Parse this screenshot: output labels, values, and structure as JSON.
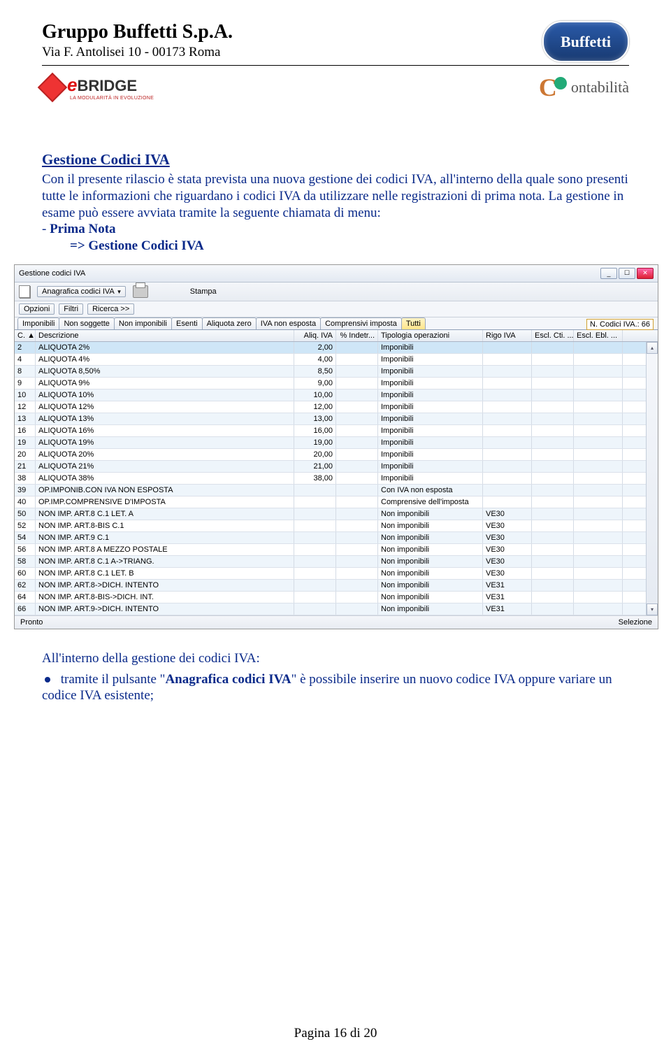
{
  "header": {
    "company": "Gruppo Buffetti S.p.A.",
    "address": "Via F. Antolisei 10 - 00173 Roma",
    "badge_text": "Buffetti"
  },
  "logos": {
    "ebridge_e": "e",
    "ebridge_name": "BRIDGE",
    "ebridge_sub": "LA MODULARITÀ IN EVOLUZIONE",
    "contab_c": "C",
    "contab_text": "ontabilità"
  },
  "section": {
    "title": "Gestione Codici IVA",
    "para1": "Con il presente rilascio è stata prevista una nuova gestione dei codici IVA, all'interno della quale sono presenti tutte le informazioni che riguardano i codici IVA da utilizzare nelle registrazioni di prima nota. La gestione in esame può essere avviata tramite la seguente chiamata di menu:",
    "menu_dash": "- ",
    "menu1": "Prima Nota",
    "menu_arrow": "=> Gestione Codici IVA"
  },
  "shot": {
    "title": "Gestione codici IVA",
    "win_min": "_",
    "win_max": "☐",
    "win_close": "✕",
    "toolbar": {
      "anag": "Anagrafica codici IVA",
      "anag_dd": "▾",
      "stampa": "Stampa"
    },
    "opts": {
      "opzioni": "Opzioni",
      "filtri": "Filtri",
      "ricerca": "Ricerca >>"
    },
    "tabs": [
      "Imponibili",
      "Non soggette",
      "Non imponibili",
      "Esenti",
      "Aliquota zero",
      "IVA non esposta",
      "Comprensivi imposta",
      "Tutti"
    ],
    "active_tab": 7,
    "ncodici": "N. Codici IVA.: 66",
    "cols": {
      "c": "C.",
      "desc": "Descrizione",
      "aliq": "Aliq. IVA",
      "ind": "% Indetr...",
      "tipo": "Tipologia operazioni",
      "rigo": "Rigo IVA",
      "escc": "Escl. Cti. ...",
      "esce": "Escl. Ebl. ..."
    },
    "col_sort": "▲",
    "rows": [
      {
        "c": "2",
        "desc": "ALIQUOTA 2%",
        "aliq": "2,00",
        "ind": "",
        "tipo": "Imponibili",
        "rigo": "",
        "escc": "",
        "esce": "",
        "sel": true
      },
      {
        "c": "4",
        "desc": "ALIQUOTA 4%",
        "aliq": "4,00",
        "ind": "",
        "tipo": "Imponibili",
        "rigo": "",
        "escc": "",
        "esce": ""
      },
      {
        "c": "8",
        "desc": "ALIQUOTA 8,50%",
        "aliq": "8,50",
        "ind": "",
        "tipo": "Imponibili",
        "rigo": "",
        "escc": "",
        "esce": ""
      },
      {
        "c": "9",
        "desc": "ALIQUOTA 9%",
        "aliq": "9,00",
        "ind": "",
        "tipo": "Imponibili",
        "rigo": "",
        "escc": "",
        "esce": ""
      },
      {
        "c": "10",
        "desc": "ALIQUOTA 10%",
        "aliq": "10,00",
        "ind": "",
        "tipo": "Imponibili",
        "rigo": "",
        "escc": "",
        "esce": ""
      },
      {
        "c": "12",
        "desc": "ALIQUOTA 12%",
        "aliq": "12,00",
        "ind": "",
        "tipo": "Imponibili",
        "rigo": "",
        "escc": "",
        "esce": ""
      },
      {
        "c": "13",
        "desc": "ALIQUOTA 13%",
        "aliq": "13,00",
        "ind": "",
        "tipo": "Imponibili",
        "rigo": "",
        "escc": "",
        "esce": ""
      },
      {
        "c": "16",
        "desc": "ALIQUOTA 16%",
        "aliq": "16,00",
        "ind": "",
        "tipo": "Imponibili",
        "rigo": "",
        "escc": "",
        "esce": ""
      },
      {
        "c": "19",
        "desc": "ALIQUOTA 19%",
        "aliq": "19,00",
        "ind": "",
        "tipo": "Imponibili",
        "rigo": "",
        "escc": "",
        "esce": ""
      },
      {
        "c": "20",
        "desc": "ALIQUOTA 20%",
        "aliq": "20,00",
        "ind": "",
        "tipo": "Imponibili",
        "rigo": "",
        "escc": "",
        "esce": ""
      },
      {
        "c": "21",
        "desc": "ALIQUOTA 21%",
        "aliq": "21,00",
        "ind": "",
        "tipo": "Imponibili",
        "rigo": "",
        "escc": "",
        "esce": ""
      },
      {
        "c": "38",
        "desc": "ALIQUOTA 38%",
        "aliq": "38,00",
        "ind": "",
        "tipo": "Imponibili",
        "rigo": "",
        "escc": "",
        "esce": ""
      },
      {
        "c": "39",
        "desc": "OP.IMPONIB.CON IVA NON ESPOSTA",
        "aliq": "",
        "ind": "",
        "tipo": "Con IVA non esposta",
        "rigo": "",
        "escc": "",
        "esce": ""
      },
      {
        "c": "40",
        "desc": "OP.IMP.COMPRENSIVE D'IMPOSTA",
        "aliq": "",
        "ind": "",
        "tipo": "Comprensive dell'imposta",
        "rigo": "",
        "escc": "",
        "esce": ""
      },
      {
        "c": "50",
        "desc": "NON IMP. ART.8 C.1 LET. A",
        "aliq": "",
        "ind": "",
        "tipo": "Non imponibili",
        "rigo": "VE30",
        "escc": "",
        "esce": ""
      },
      {
        "c": "52",
        "desc": "NON IMP. ART.8-BIS C.1",
        "aliq": "",
        "ind": "",
        "tipo": "Non imponibili",
        "rigo": "VE30",
        "escc": "",
        "esce": ""
      },
      {
        "c": "54",
        "desc": "NON IMP. ART.9 C.1",
        "aliq": "",
        "ind": "",
        "tipo": "Non imponibili",
        "rigo": "VE30",
        "escc": "",
        "esce": ""
      },
      {
        "c": "56",
        "desc": "NON IMP. ART.8 A MEZZO POSTALE",
        "aliq": "",
        "ind": "",
        "tipo": "Non imponibili",
        "rigo": "VE30",
        "escc": "",
        "esce": ""
      },
      {
        "c": "58",
        "desc": "NON IMP. ART.8 C.1 A->TRIANG.",
        "aliq": "",
        "ind": "",
        "tipo": "Non imponibili",
        "rigo": "VE30",
        "escc": "",
        "esce": ""
      },
      {
        "c": "60",
        "desc": "NON IMP. ART.8 C.1 LET. B",
        "aliq": "",
        "ind": "",
        "tipo": "Non imponibili",
        "rigo": "VE30",
        "escc": "",
        "esce": ""
      },
      {
        "c": "62",
        "desc": "NON IMP. ART.8->DICH. INTENTO",
        "aliq": "",
        "ind": "",
        "tipo": "Non imponibili",
        "rigo": "VE31",
        "escc": "",
        "esce": ""
      },
      {
        "c": "64",
        "desc": "NON IMP. ART.8-BIS->DICH. INT.",
        "aliq": "",
        "ind": "",
        "tipo": "Non imponibili",
        "rigo": "VE31",
        "escc": "",
        "esce": ""
      },
      {
        "c": "66",
        "desc": "NON IMP. ART.9->DICH. INTENTO",
        "aliq": "",
        "ind": "",
        "tipo": "Non imponibili",
        "rigo": "VE31",
        "escc": "",
        "esce": ""
      }
    ],
    "status_left": "Pronto",
    "status_right": "Selezione",
    "sb_up": "▴",
    "sb_down": "▾"
  },
  "after": {
    "line1": "All'interno della gestione dei codici IVA:",
    "bullet_pre": "tramite il pulsante \"",
    "bullet_bold": "Anagrafica codici IVA",
    "bullet_post": "\" è possibile inserire un nuovo codice IVA oppure variare un codice IVA esistente;"
  },
  "footer": "Pagina 16 di 20"
}
